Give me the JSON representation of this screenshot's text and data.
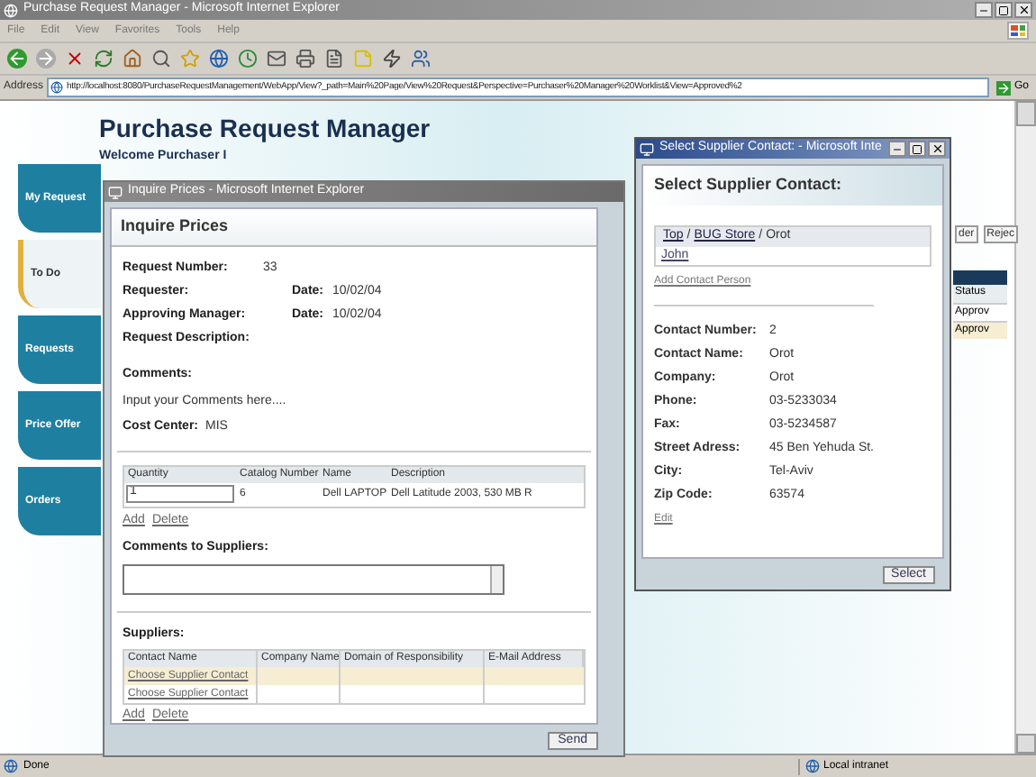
{
  "browser": {
    "title": "Purchase Request Manager - Microsoft Internet Explorer",
    "menu": [
      "File",
      "Edit",
      "View",
      "Favorites",
      "Tools",
      "Help"
    ],
    "address_label": "Address",
    "url": "http://localhost:8080/PurchaseRequestManagement/WebApp/View?_path=Main%20Page/View%20Request&Perspective=Purchaser%20Manager%20Worklist&View=Approved%2",
    "go": "Go",
    "status": "Done",
    "zone": "Local intranet"
  },
  "page": {
    "title": "Purchase Request Manager",
    "welcome": "Welcome Purchaser I",
    "tabs": [
      {
        "label": "My Request",
        "selected": false
      },
      {
        "label": "To Do",
        "selected": true
      },
      {
        "label": "Requests",
        "selected": false
      },
      {
        "label": "Price Offer",
        "selected": false
      },
      {
        "label": "Orders",
        "selected": false
      }
    ],
    "buttons": [
      "der",
      "Rejec"
    ],
    "table": {
      "column": "Status",
      "rows": [
        {
          "text": "Approv",
          "selected": false
        },
        {
          "text": "Approv",
          "selected": true
        }
      ]
    }
  },
  "inquire": {
    "window_title": "Inquire Prices - Microsoft Internet Explorer",
    "heading": "Inquire Prices",
    "fields": [
      {
        "label": "Request Number:",
        "value": "33"
      },
      {
        "label": "Requester:",
        "date_label": "Date:",
        "date": "10/02/04"
      },
      {
        "label": "Approving Manager:",
        "date_label": "Date:",
        "date": "10/02/04"
      },
      {
        "label": "Request Description:"
      }
    ],
    "comments_label": "Comments:",
    "comments": "Input your Comments here....",
    "cost_center_label": "Cost Center:",
    "cost_center": "MIS",
    "items": {
      "columns": [
        "Quantity",
        "Catalog Number",
        "Name",
        "Description"
      ],
      "rows": [
        {
          "quantity": "1",
          "catalog": "6",
          "name": "Dell LAPTOP",
          "description": "Dell Latitude 2003, 530 MB R"
        }
      ]
    },
    "item_links": [
      "Add",
      "Delete"
    ],
    "supplier_comments_label": "Comments to Suppliers:",
    "suppliers_label": "Suppliers:",
    "suppliers": {
      "columns": [
        "Contact Name",
        "Company Name",
        "Domain of Responsibility",
        "E-Mail Address"
      ],
      "rows": [
        {
          "contact": "Choose Supplier Contact",
          "selected": true
        },
        {
          "contact": "Choose Supplier Contact",
          "selected": false
        }
      ]
    },
    "supplier_links": [
      "Add",
      "Delete"
    ],
    "send": "Send"
  },
  "supplier": {
    "window_title": "Select Supplier Contact: - Microsoft Inte",
    "heading": "Select Supplier Contact:",
    "breadcrumb_separator": "/",
    "breadcrumb": [
      {
        "text": "Top",
        "link": true
      },
      {
        "text": "BUG Store",
        "link": true
      },
      {
        "text": "Orot",
        "link": false
      }
    ],
    "contacts": [
      "John"
    ],
    "add_contact": "Add Contact Person",
    "details": [
      {
        "label": "Contact Number:",
        "value": "2"
      },
      {
        "label": "Contact Name:",
        "value": "Orot"
      },
      {
        "label": "Company:",
        "value": "Orot"
      },
      {
        "label": "Phone:",
        "value": "03-5233034"
      },
      {
        "label": "Fax:",
        "value": "03-5234587"
      },
      {
        "label": "Street Adress:",
        "value": "45 Ben Yehuda St."
      },
      {
        "label": "City:",
        "value": "Tel-Aviv"
      },
      {
        "label": "Zip Code:",
        "value": "63574"
      }
    ],
    "edit": "Edit",
    "select": "Select"
  }
}
